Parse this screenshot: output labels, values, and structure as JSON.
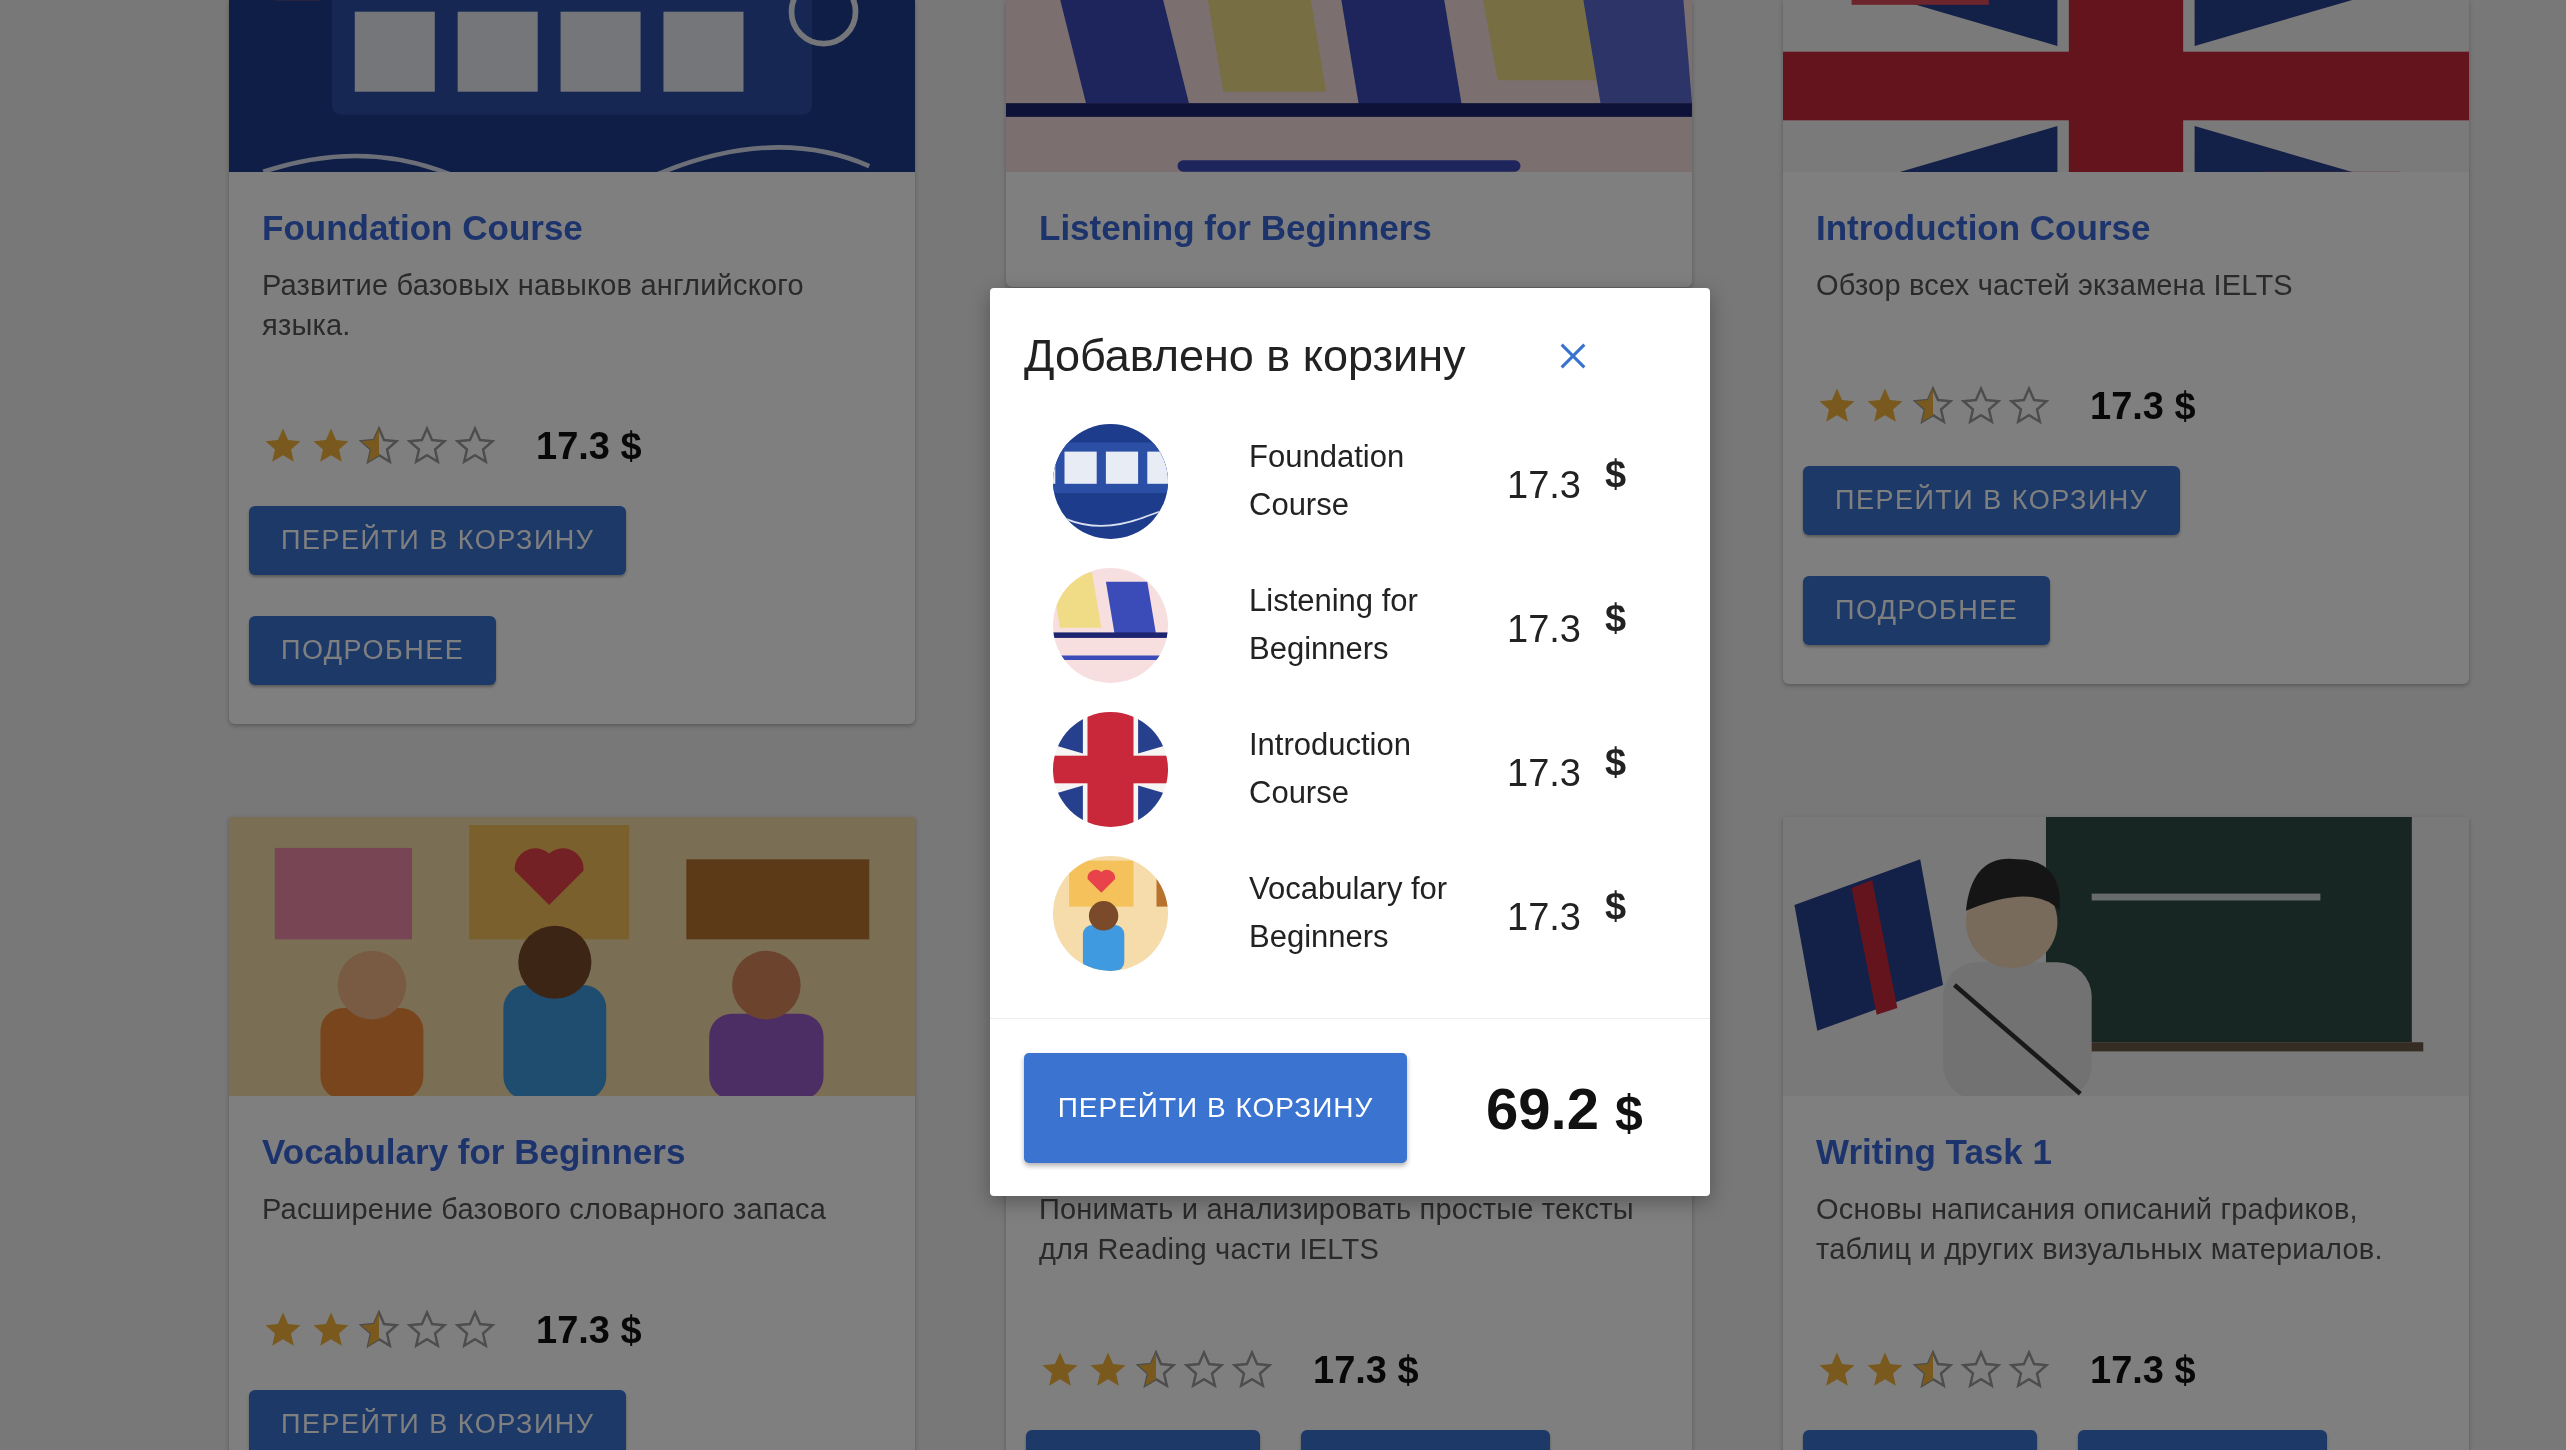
{
  "courses": [
    {
      "title": "Foundation Course",
      "description": "Развитие базовых навыков английского языка.",
      "stars": 2.5,
      "price": "17.3 $",
      "buttons": [
        {
          "kind": "button",
          "label": "ПЕРЕЙТИ В КОРЗИНУ"
        },
        {
          "kind": "button",
          "label": "ПОДРОБНЕЕ"
        }
      ],
      "image": {
        "kind": "picture"
      }
    },
    {
      "title": "Listening for Beginners",
      "image": {
        "kind": "picture"
      }
    },
    {
      "title": "Introduction Course",
      "description": "Обзор всех частей экзамена IELTS",
      "stars": 2.5,
      "price": "17.3 $",
      "buttons": [
        {
          "kind": "button",
          "label": "ПЕРЕЙТИ В КОРЗИНУ"
        },
        {
          "kind": "button",
          "label": "ПОДРОБНЕЕ"
        }
      ],
      "image": {
        "kind": "picture"
      }
    },
    {
      "title": "Vocabulary for Beginners",
      "description": "Расширение базового словарного запаса",
      "stars": 2.5,
      "price": "17.3 $",
      "buttons": [
        {
          "kind": "button",
          "label": "ПЕРЕЙТИ В КОРЗИНУ"
        }
      ],
      "image": {
        "kind": "picture"
      }
    },
    {
      "description": "Понимать и анализировать простые тексты для Reading части IELTS",
      "stars": 2.5,
      "price": "17.3 $",
      "buttons": [
        {
          "kind": "button"
        },
        {
          "kind": "button"
        }
      ]
    },
    {
      "title": "Writing Task 1",
      "description": "Основы написания описаний графиков, таблиц и других визуальных материалов.",
      "stars": 2.5,
      "price": "17.3 $",
      "buttons": [
        {
          "kind": "button"
        },
        {
          "kind": "button"
        }
      ],
      "image": {
        "kind": "picture"
      }
    }
  ],
  "cart_dialog": {
    "title": "Добавлено в корзину",
    "items": [
      {
        "name": "Foundation Course",
        "price": "17.3",
        "currency": "$",
        "image": {
          "kind": "picture"
        }
      },
      {
        "name": "Listening for Beginners",
        "price": "17.3",
        "currency": "$",
        "image": {
          "kind": "picture"
        }
      },
      {
        "name": "Introduction Course",
        "price": "17.3",
        "currency": "$",
        "image": {
          "kind": "picture"
        }
      },
      {
        "name": "Vocabulary for Beginners",
        "price": "17.3",
        "currency": "$",
        "image": {
          "kind": "picture"
        }
      }
    ],
    "checkout_button": "ПЕРЕЙТИ В КОРЗИНУ",
    "total": "69.2",
    "total_currency": "$"
  }
}
